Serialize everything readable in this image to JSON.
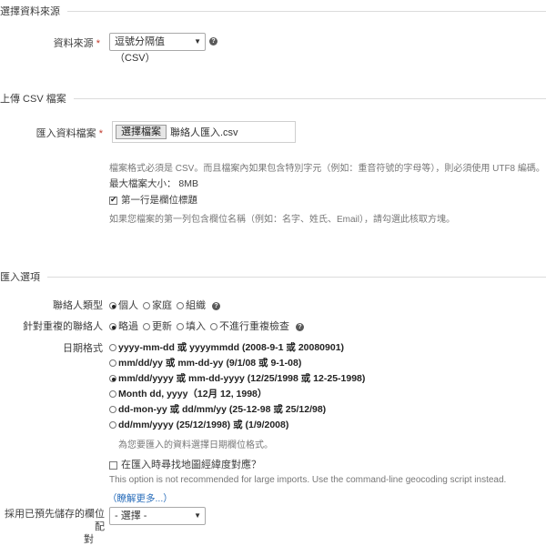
{
  "data_source": {
    "section_title": "選擇資料來源",
    "label": "資料來源",
    "required_mark": "*",
    "selected": "逗號分隔值（CSV）",
    "help_icon": "question-circle-icon"
  },
  "upload": {
    "section_title": "上傳 CSV 檔案",
    "label": "匯入資料檔案",
    "required_mark": "*",
    "choose_button": "選擇檔案",
    "file_name": "聯絡人匯入.csv",
    "format_note": "檔案格式必須是 CSV。而且檔案內如果包含特別字元（例如：重音符號的字母等），則必須使用 UTF8 編碼。",
    "max_size": "最大檔案大小： 8MB",
    "first_row_header_label": "第一行是欄位標題",
    "first_row_header_checked": true,
    "first_row_note": "如果您檔案的第一列包含欄位名稱（例如：名字、姓氏、Email），請勾選此核取方塊。"
  },
  "options": {
    "section_title": "匯入選項",
    "contact_type": {
      "label": "聯絡人類型",
      "options": [
        "個人",
        "家庭",
        "組織"
      ],
      "selected_index": 0
    },
    "dedupe": {
      "label": "針對重複的聯絡人",
      "options": [
        "略過",
        "更新",
        "填入",
        "不進行重複檢查"
      ],
      "selected_index": 0
    },
    "date_format": {
      "label": "日期格式",
      "options": [
        "yyyy-mm-dd 或 yyyymmdd (2008-9-1 或 20080901)",
        "mm/dd/yy 或 mm-dd-yy (9/1/08 或 9-1-08)",
        "mm/dd/yyyy 或 mm-dd-yyyy (12/25/1998 或 12-25-1998)",
        "Month dd, yyyy（12月 12, 1998）",
        "dd-mon-yy 或 dd/mm/yy (25-12-98 或 25/12/98)",
        "dd/mm/yyyy (25/12/1998) 或 (1/9/2008)"
      ],
      "selected_index": 2,
      "note": "為您要匯入的資料選擇日期欄位格式。"
    },
    "geocode": {
      "label": "在匯入時尋找地圖經緯度對應？",
      "checked": false,
      "note": "This option is not recommended for large imports. Use the command-line geocoding script instead.",
      "learn_more": "（瞭解更多...）"
    },
    "saved_mapping": {
      "label_line1": "採用已預先儲存的欄位配",
      "label_line2": "對",
      "selected": "- 選擇 -"
    }
  }
}
